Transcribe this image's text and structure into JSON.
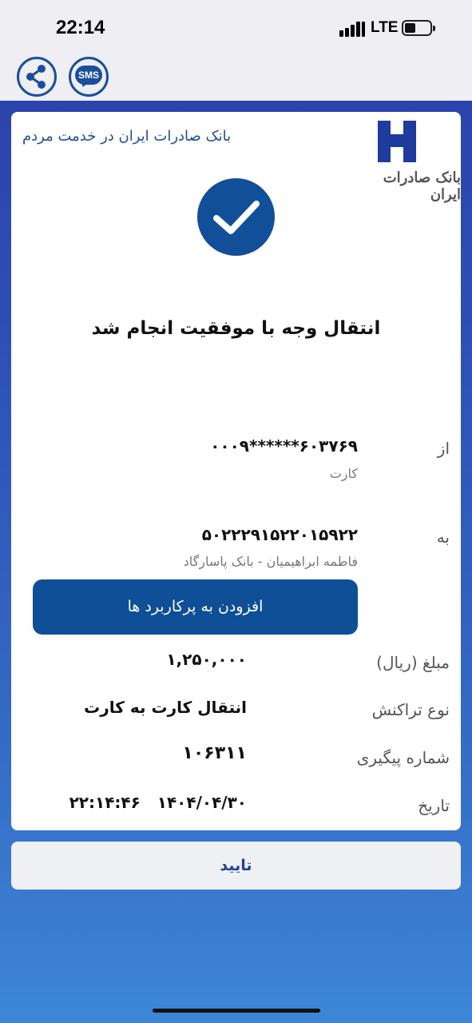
{
  "status_bar": {
    "time": "22:14",
    "network": "LTE",
    "icons": [
      "signal-icon",
      "battery-icon"
    ]
  },
  "toolbar": {
    "share_icon": "share-icon",
    "sms_label": "SMS"
  },
  "receipt": {
    "bank_tagline": "بانک صادرات ایران در خدمت مردم",
    "logo_text": "بانک صادرات ایران",
    "success_title": "انتقال وجه با موفقیت انجام شد",
    "from": {
      "label": "از",
      "value": "۶۰۳۷۶۹******۰۰۰۹",
      "sub": "کارت"
    },
    "to": {
      "label": "به",
      "value": "۵۰۲۲۲۹۱۵۲۲۰۱۵۹۲۲",
      "sub": "فاطمه ابراهیمیان - بانک پاسارگاد"
    },
    "add_button_label": "افزودن به پرکاربرد ها",
    "amount": {
      "label": "مبلغ (ریال)",
      "value": "۱,۲۵۰,۰۰۰"
    },
    "transaction_type": {
      "label": "نوع تراکنش",
      "value": "انتقال کارت به کارت"
    },
    "tracking_number": {
      "label": "شماره پیگیری",
      "value": "۱۰۶۳۱۱"
    },
    "date": {
      "label": "تاریخ",
      "value": "۱۴۰۴/۰۴/۳۰   ۲۲:۱۴:۴۶"
    }
  },
  "confirm_label": "تایید",
  "colors": {
    "brand_blue": "#124f99",
    "confirm_text": "#233e9a",
    "background_top": "#2a3fa8",
    "background_bottom": "#3d86d6"
  }
}
